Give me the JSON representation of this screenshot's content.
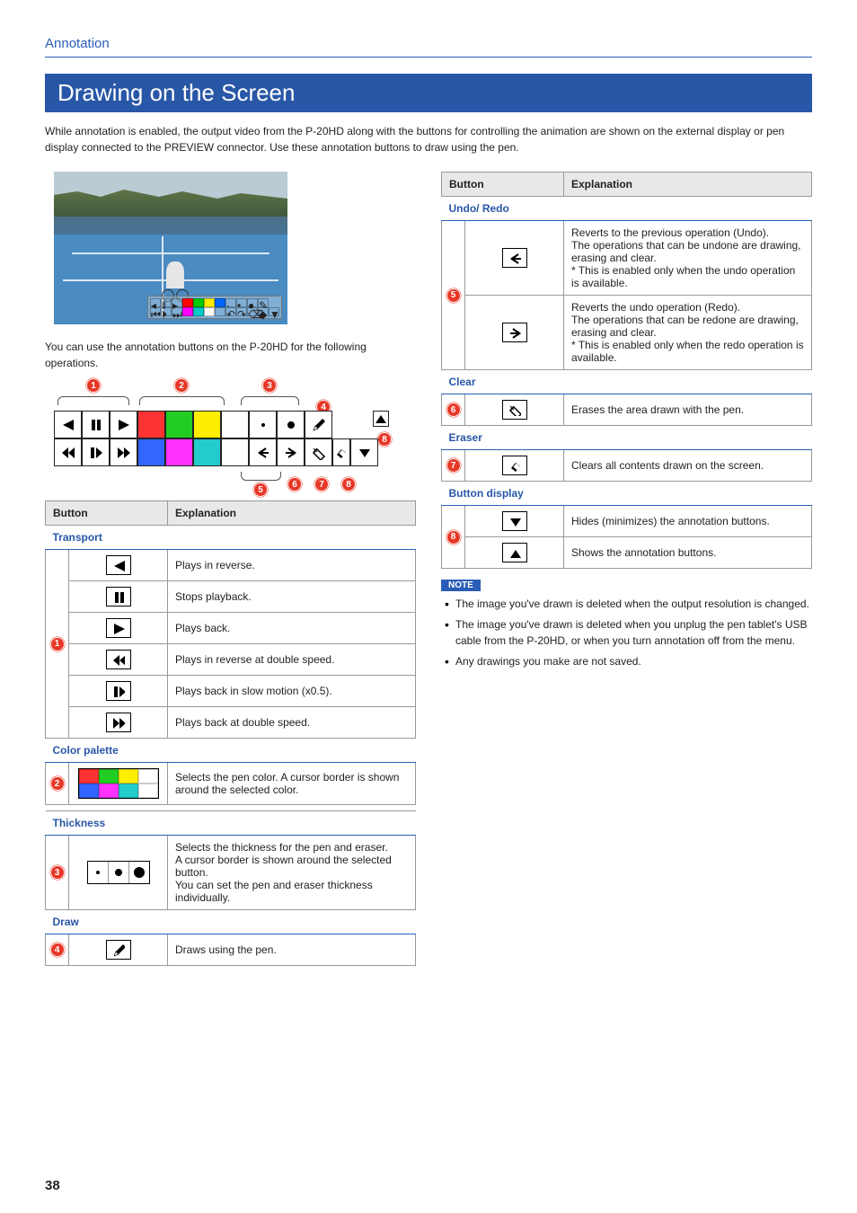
{
  "section": "Annotation",
  "title": "Drawing on the Screen",
  "intro": "While annotation is enabled, the output video from the P-20HD along with the buttons for controlling the animation are shown on the external display or pen display connected to the PREVIEW connector. Use these annotation buttons to draw using the pen.",
  "para1": "You can use the annotation buttons on the P-20HD for the following operations.",
  "headers": {
    "button": "Button",
    "explanation": "Explanation"
  },
  "groups": {
    "transport": "Transport",
    "color": "Color palette",
    "thickness": "Thickness",
    "draw": "Draw",
    "undo": "Undo/ Redo",
    "clear": "Clear",
    "eraser": "Eraser",
    "btndisp": "Button display"
  },
  "rows": {
    "reverse": "Plays in reverse.",
    "stop": "Stops playback.",
    "play": "Plays back.",
    "reverse2x": "Plays in reverse at double speed.",
    "slow": "Plays back in slow motion (x0.5).",
    "play2x": "Plays back at double speed.",
    "color": "Selects the pen color. A cursor border is shown around the selected color.",
    "thickness": "Selects the thickness for the pen and eraser.\nA cursor border is shown around the selected button.\nYou can set the pen and eraser thickness individually.",
    "draw": "Draws using the pen.",
    "undo": "Reverts to the previous operation (Undo).\nThe operations that can be undone are drawing, erasing and clear.\n* This is enabled only when the undo operation is available.",
    "redo": "Reverts the undo operation (Redo).\nThe operations that can be redone are drawing, erasing and clear.\n* This is enabled only when the redo operation is available.",
    "clear": "Erases the area drawn with the pen.",
    "eraser": "Clears all contents drawn on the screen.",
    "hide": "Hides (minimizes) the annotation buttons.",
    "show": "Shows the annotation buttons."
  },
  "noteLabel": "NOTE",
  "notes": [
    "The image you've drawn is deleted when the output resolution is changed.",
    "The image you've drawn is deleted when you unplug the pen tablet's USB cable from the P-20HD, or when you turn annotation off from the menu.",
    "Any drawings you make are not saved."
  ],
  "pageNumber": "38"
}
